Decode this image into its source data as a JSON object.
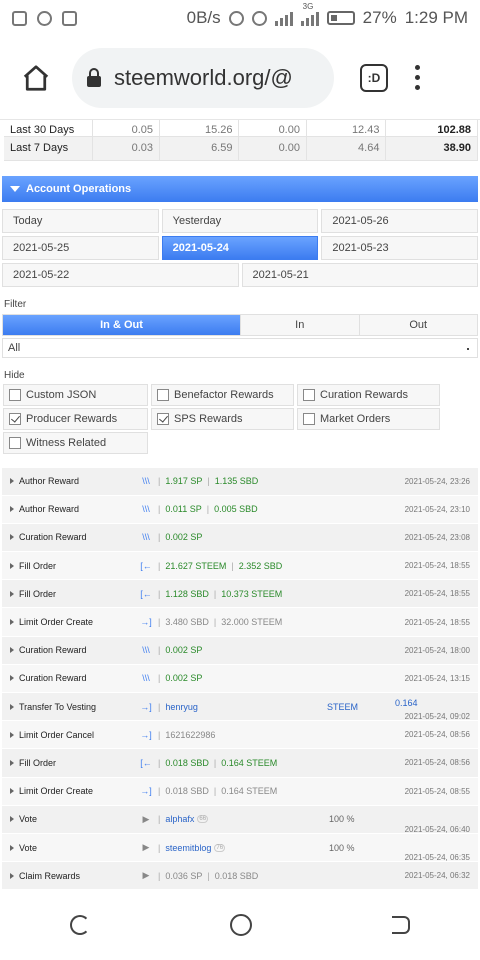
{
  "status_bar": {
    "net_speed": "0B/s",
    "signal_tag": "3G",
    "battery": "27%",
    "time": "1:29 PM"
  },
  "browser": {
    "url": "steemworld.org/@",
    "tab_label": ":D"
  },
  "summary": {
    "rows": [
      {
        "label": "Last 30 Days",
        "c1": "0.05",
        "c2": "15.26",
        "c3": "0.00",
        "c4": "12.43",
        "total": "102.88"
      },
      {
        "label": "Last 7 Days",
        "c1": "0.03",
        "c2": "6.59",
        "c3": "0.00",
        "c4": "4.64",
        "total": "38.90"
      }
    ]
  },
  "account_operations": {
    "title": "Account Operations",
    "dates_row1": [
      "Today",
      "Yesterday",
      "2021-05-26"
    ],
    "dates_row2": [
      "2021-05-25",
      "2021-05-24",
      "2021-05-23"
    ],
    "dates_row3": [
      "2021-05-22",
      "2021-05-21"
    ],
    "active_date": "2021-05-24",
    "filter_label": "Filter",
    "filter_options": [
      "In & Out",
      "In",
      "Out"
    ],
    "filter_selected": "In & Out",
    "select_value": "All",
    "hide_label": "Hide",
    "hide_options": [
      {
        "label": "Custom JSON",
        "checked": false
      },
      {
        "label": "Benefactor Rewards",
        "checked": false
      },
      {
        "label": "Curation Rewards",
        "checked": false
      },
      {
        "label": "Producer Rewards",
        "checked": true
      },
      {
        "label": "SPS Rewards",
        "checked": true
      },
      {
        "label": "Market Orders",
        "checked": false
      },
      {
        "label": "Witness Related",
        "checked": false
      }
    ]
  },
  "operations": [
    {
      "name": "Author Reward",
      "icon": "reward-icon",
      "v1": "1.917 SP",
      "v2": "1.135 SBD",
      "date": "2021-05-24, 23:26"
    },
    {
      "name": "Author Reward",
      "icon": "reward-icon",
      "v1": "0.011 SP",
      "v2": "0.005 SBD",
      "date": "2021-05-24, 23:10"
    },
    {
      "name": "Curation Reward",
      "icon": "reward-icon",
      "v1": "0.002 SP",
      "v2": "",
      "date": "2021-05-24, 23:08"
    },
    {
      "name": "Fill Order",
      "icon": "order-in-icon",
      "v1": "21.627 STEEM",
      "v2": "2.352 SBD",
      "date": "2021-05-24, 18:55"
    },
    {
      "name": "Fill Order",
      "icon": "order-in-icon",
      "v1": "1.128 SBD",
      "v2": "10.373 STEEM",
      "date": "2021-05-24, 18:55"
    },
    {
      "name": "Limit Order Create",
      "icon": "order-out-icon",
      "v1": "3.480 SBD",
      "v2": "32.000 STEEM",
      "date": "2021-05-24, 18:55"
    },
    {
      "name": "Curation Reward",
      "icon": "reward-icon",
      "v1": "0.002 SP",
      "v2": "",
      "date": "2021-05-24, 18:00"
    },
    {
      "name": "Curation Reward",
      "icon": "reward-icon",
      "v1": "0.002 SP",
      "v2": "",
      "date": "2021-05-24, 13:15"
    },
    {
      "name": "Transfer To Vesting",
      "icon": "order-out-icon",
      "v1": "henryug",
      "v2": "",
      "extra1": "STEEM",
      "extra2": "0.164",
      "date": "2021-05-24, 09:02"
    },
    {
      "name": "Limit Order Cancel",
      "icon": "order-out-icon",
      "v1": "1621622986",
      "v2": "",
      "date": "2021-05-24, 08:56"
    },
    {
      "name": "Fill Order",
      "icon": "order-in-icon",
      "v1": "0.018 SBD",
      "v2": "0.164 STEEM",
      "date": "2021-05-24, 08:56"
    },
    {
      "name": "Limit Order Create",
      "icon": "order-out-icon",
      "v1": "0.018 SBD",
      "v2": "0.164 STEEM",
      "date": "2021-05-24, 08:55"
    },
    {
      "name": "Vote",
      "icon": "play-icon",
      "v1": "alphafx",
      "badge": "66",
      "v2": "",
      "extra1": "100 %",
      "date": "2021-05-24, 06:40"
    },
    {
      "name": "Vote",
      "icon": "play-icon",
      "v1": "steemitblog",
      "badge": "76",
      "v2": "",
      "extra1": "100 %",
      "date": "2021-05-24, 06:35"
    },
    {
      "name": "Claim Rewards",
      "icon": "play-icon",
      "v1": "0.036 SP",
      "v2": "0.018 SBD",
      "date": "2021-05-24, 06:32"
    }
  ]
}
